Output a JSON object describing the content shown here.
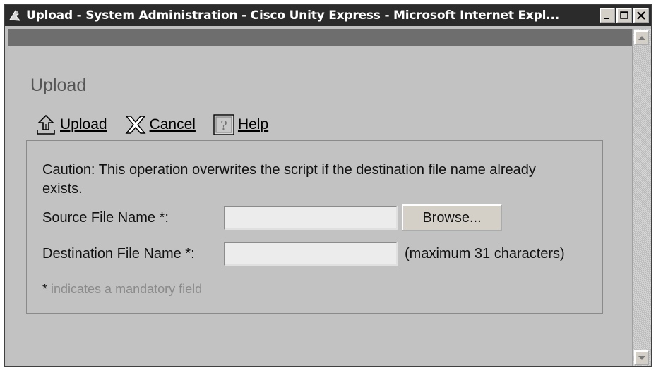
{
  "window": {
    "title": "Upload - System Administration - Cisco Unity Express - Microsoft Internet Expl...",
    "minimize_label": "_",
    "maximize_label": "□",
    "close_label": "✕"
  },
  "page": {
    "title": "Upload"
  },
  "toolbar": {
    "upload_label": "Upload",
    "cancel_label": "Cancel",
    "help_label": "Help"
  },
  "form": {
    "caution": "Caution: This operation overwrites the script if the destination file name already exists.",
    "source_label": "Source File Name *:",
    "source_value": "",
    "browse_label": "Browse...",
    "destination_label": "Destination File Name *:",
    "destination_value": "",
    "destination_hint": "(maximum 31 characters)",
    "mandatory_star": "*",
    "mandatory_text": " indicates a mandatory field"
  },
  "colors": {
    "titlebar": "#2b2b2b",
    "header_band": "#6e6e6e",
    "page_bg": "#c2c2c2",
    "page_title": "#555555",
    "muted_text": "#8a8a8a"
  },
  "icons": {
    "app": "ie-app-icon",
    "upload": "upload-icon",
    "cancel": "cancel-x-icon",
    "help": "help-question-icon"
  }
}
